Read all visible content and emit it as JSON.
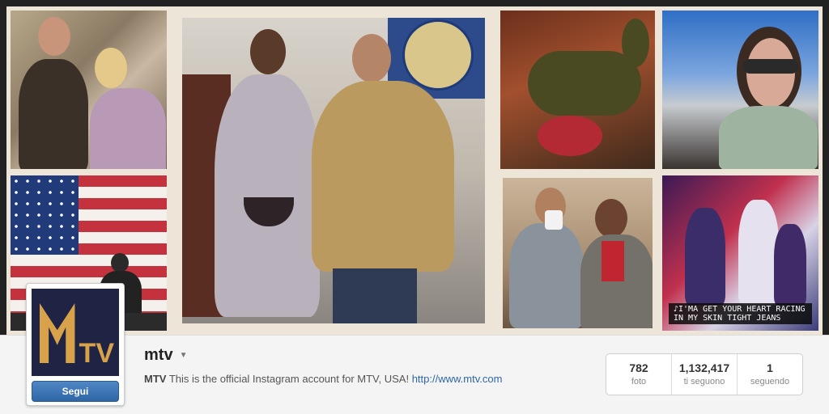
{
  "gallery": {
    "photo_caption": "♪I'MA GET YOUR HEART RACING IN MY SKIN TIGHT JEANS"
  },
  "profile": {
    "username": "mtv",
    "follow_label": "Segui",
    "bio_name": "MTV",
    "bio_text": "This is the official Instagram account for MTV, USA!",
    "bio_link": "http://www.mtv.com",
    "avatar_logo_letters": "TV"
  },
  "stats": [
    {
      "value": "782",
      "label": "foto"
    },
    {
      "value": "1,132,417",
      "label": "ti seguono"
    },
    {
      "value": "1",
      "label": "seguendo"
    }
  ],
  "colors": {
    "button": "#2f66a5",
    "link": "#2f66a5"
  }
}
